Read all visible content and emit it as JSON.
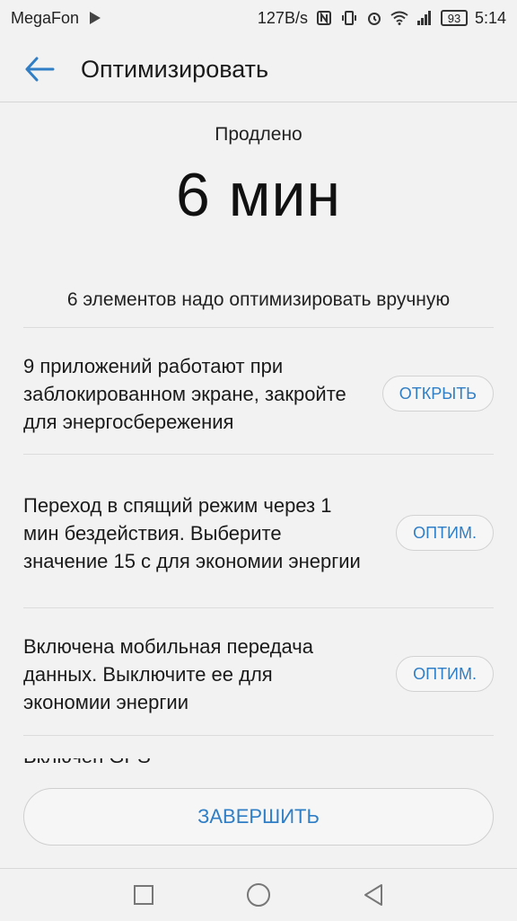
{
  "status_bar": {
    "carrier": "MegaFon",
    "net_speed": "127B/s",
    "battery": "93",
    "time": "5:14"
  },
  "header": {
    "title": "Оптимизировать"
  },
  "summary": {
    "label": "Продлено",
    "value": "6 мин"
  },
  "manual_note": "6 элементов надо оптимизировать вручную",
  "items": [
    {
      "text": "9 приложений работают при заблокированном экране, закройте для энергосбережения",
      "button": "ОТКРЫТЬ"
    },
    {
      "text": "Переход в спящий режим через 1 мин бездействия. Выберите значение 15 с для экономии энергии",
      "button": "ОПТИМ."
    },
    {
      "text": "Включена мобильная передача данных. Выключите ее для экономии энергии",
      "button": "ОПТИМ."
    }
  ],
  "partial_item": "Включен GPS",
  "finish_button": "ЗАВЕРШИТЬ",
  "colors": {
    "accent": "#2f7ec6",
    "background": "#f2f2f2"
  },
  "nav_icons": [
    "recent-apps-icon",
    "home-icon",
    "back-icon"
  ]
}
